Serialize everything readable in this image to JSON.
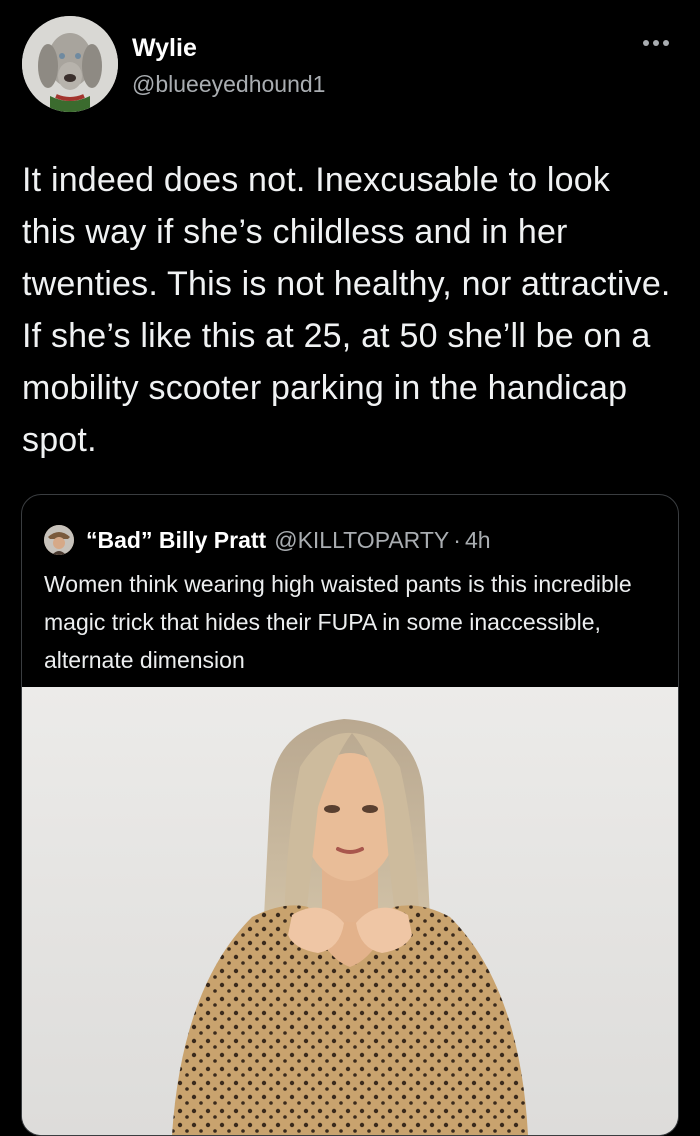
{
  "tweet": {
    "author": {
      "name": "Wylie",
      "handle": "@blueeyedhound1"
    },
    "text": "It indeed does not. Inexcusable to look this way if she’s childless and in her twenties. This is not healthy, nor attractive. If she’s like this at 25, at 50 she’ll be on a mobility scooter parking in the handicap spot.",
    "more_icon": "more-horizontal-icon"
  },
  "quoted_tweet": {
    "author": {
      "name": "“Bad” Billy Pratt",
      "handle": "@KILLTOPARTY",
      "separator": "·",
      "time": "4h"
    },
    "text": "Women think wearing high waisted pants is this incredible magic trick that hides their FUPA in some inaccessible, alternate dimension",
    "media": "photo"
  },
  "colors": {
    "background": "#000000",
    "text": "#e7e9ea",
    "secondary_text": "#a9adb1",
    "border": "#3a3d40"
  }
}
